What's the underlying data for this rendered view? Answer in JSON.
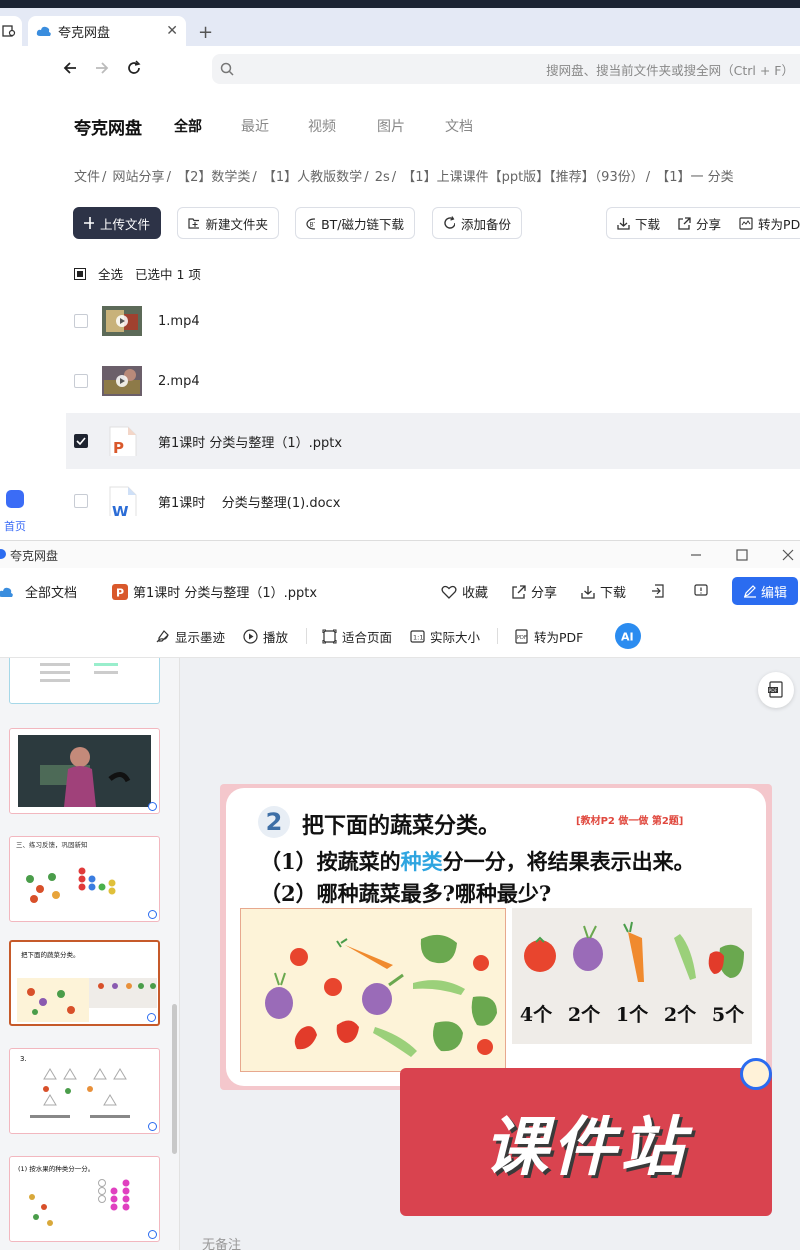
{
  "browser": {
    "tab_title": "夸克网盘",
    "close_glyph": "✕",
    "new_tab_glyph": "+",
    "search_placeholder": "搜网盘、搜当前文件夹或搜全网（Ctrl + F）"
  },
  "app": {
    "brand": "夸克网盘",
    "tabs": [
      "全部",
      "最近",
      "视频",
      "图片",
      "文档"
    ],
    "active_tab": "全部",
    "breadcrumb": [
      "文件",
      "网站分享",
      "【2】数学类",
      "【1】人教版数学",
      "2s",
      "【1】上课课件【ppt版】【推荐】（93份）",
      "【1】一 分类"
    ],
    "breadcrumb_sep": "/",
    "actions": {
      "upload": "上传文件",
      "new_folder": "新建文件夹",
      "bt_download": "BT/磁力链下载",
      "add_backup": "添加备份",
      "download": "下载",
      "share": "分享",
      "to_pdf": "转为PDF"
    },
    "select_all": "全选",
    "selected_info": "已选中  1  项",
    "files": [
      {
        "name": "1.mp4",
        "type": "video",
        "checked": false
      },
      {
        "name": "2.mp4",
        "type": "video",
        "checked": false
      },
      {
        "name": "第1课时 分类与整理（1）.pptx",
        "type": "pptx",
        "checked": true
      },
      {
        "name": "第1课时    分类与整理(1).docx",
        "type": "docx",
        "checked": false
      }
    ],
    "home_label": "首页"
  },
  "viewer": {
    "window_title": "夸克网盘",
    "all_docs": "全部文档",
    "file_title": "第1课时 分类与整理（1）.pptx",
    "favorite": "收藏",
    "share": "分享",
    "download": "下载",
    "edit": "编辑",
    "tools": {
      "show_ink": "显示墨迹",
      "play": "播放",
      "fit_page": "适合页面",
      "actual_size": "实际大小",
      "to_pdf": "转为PDF"
    },
    "thumbnails": [
      {
        "text": ""
      },
      {
        "text": ""
      },
      {
        "text": "三、练习反馈，巩固新知"
      },
      {
        "text": "把下面的蔬菜分类。"
      },
      {
        "text": "3."
      },
      {
        "text": "(1) 按水果的种类分一分。"
      }
    ],
    "current_thumbnail": 3,
    "no_notes": "无备注"
  },
  "slide": {
    "number": "2",
    "title": "把下面的蔬菜分类。",
    "reference": "[教材P2 做一做 第2题]",
    "line1_prefix": "（1）按蔬菜的",
    "line1_highlight": "种类",
    "line1_suffix": "分一分，将结果表示出来。",
    "line2": "（2）哪种蔬菜最多?哪种最少?",
    "counts": [
      "4个",
      "2个",
      "1个",
      "2个",
      "5个"
    ],
    "watermark": "课件站"
  },
  "colors": {
    "accent_blue": "#2b6cf0",
    "dark_button": "#2d3347",
    "highlight_cyan": "#2ea5e0",
    "watermark_red": "#d9434f"
  }
}
